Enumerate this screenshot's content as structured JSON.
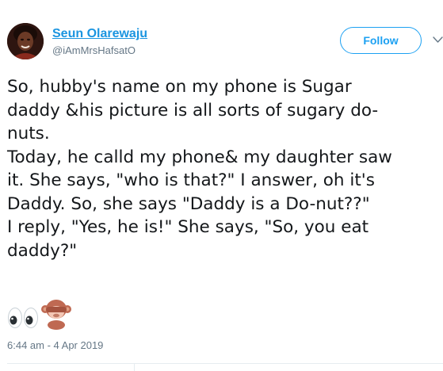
{
  "author": {
    "display_name": "Seun Olarewaju",
    "handle": "@iAmMrsHafsatO"
  },
  "follow_button": {
    "label": "Follow"
  },
  "tweet": {
    "text_lines": [
      "So, hubby's name on my phone is Sugar",
      "daddy &his picture is all sorts of sugary do-",
      "nuts.",
      "Today, he calld my phone& my daughter saw",
      "it. She says, \"who is that?\" I answer, oh it's",
      "Daddy. So, she says \"Daddy is a Do-nut??\"",
      "I reply, \"Yes, he is!\" She says, \"So, you eat",
      "daddy?\""
    ],
    "emojis": [
      "eyes-emoji",
      "see-no-evil-monkey-emoji"
    ],
    "timestamp": "6:44 am - 4 Apr 2019"
  },
  "colors": {
    "link_blue": "#1b95e0",
    "button_blue": "#1da1f2",
    "secondary_text": "#657786",
    "body_text": "#14171a",
    "divider": "#e6ecf0"
  },
  "icons": {
    "caret": "chevron-down-icon",
    "avatar": "profile-photo"
  }
}
